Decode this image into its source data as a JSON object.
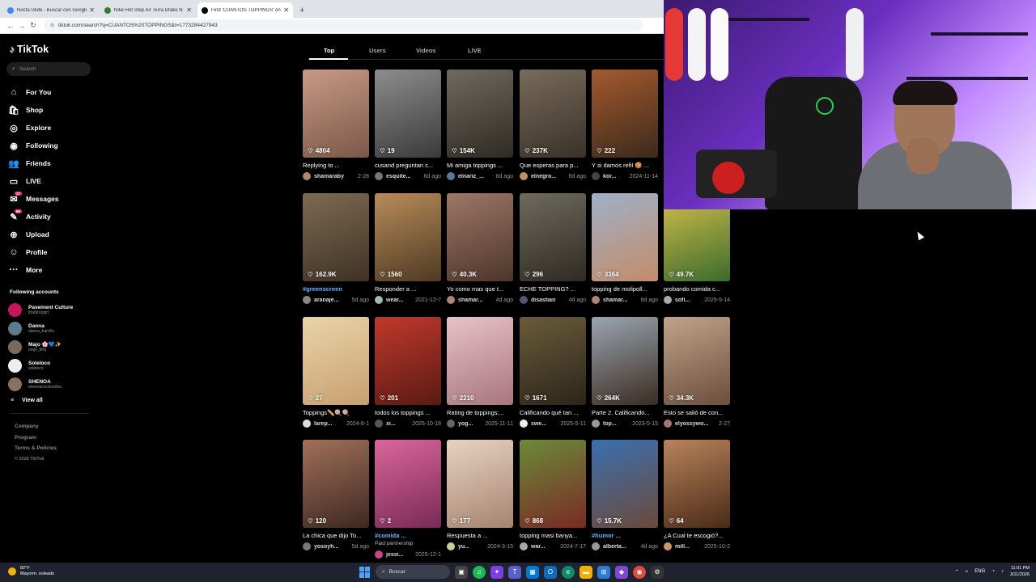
{
  "browser": {
    "tabs": [
      {
        "title": "Nocta Glide - Buscar con Google",
        "color": "#4285f4",
        "active": false
      },
      {
        "title": "Nike Hot Step Air Terra Drake N",
        "color": "#2e7d32",
        "active": false
      },
      {
        "title": "Find 'CUANTOS TOPPINGS' on T",
        "color": "#000000",
        "active": true
      }
    ],
    "new_tab": "+",
    "url": "tiktok.com/search?q=CUANTOS%20TOPPINGS&t=1773284427943"
  },
  "sidebar": {
    "logo": "TikTok",
    "search_placeholder": "Search",
    "nav": [
      {
        "label": "For You",
        "icon": "home-icon"
      },
      {
        "label": "Shop",
        "icon": "shop-icon"
      },
      {
        "label": "Explore",
        "icon": "compass-icon"
      },
      {
        "label": "Following",
        "icon": "following-icon"
      },
      {
        "label": "Friends",
        "icon": "friends-icon"
      },
      {
        "label": "LIVE",
        "icon": "live-icon"
      },
      {
        "label": "Messages",
        "icon": "messages-icon",
        "badge": "17"
      },
      {
        "label": "Activity",
        "icon": "activity-icon",
        "badge": "66"
      },
      {
        "label": "Upload",
        "icon": "upload-icon"
      },
      {
        "label": "Profile",
        "icon": "profile-icon"
      },
      {
        "label": "More",
        "icon": "more-icon"
      }
    ],
    "following_title": "Following accounts",
    "following": [
      {
        "name": "Pavement Culture",
        "handle": "thatdropgirl",
        "color": "#c2185b"
      },
      {
        "name": "Danna",
        "handle": "danna_barri0s",
        "color": "#5d7b8a"
      },
      {
        "name": "Majo 🌸💙✨",
        "handle": "majo_bhq",
        "color": "#7a6a5d"
      },
      {
        "name": "Soleloco",
        "handle": "soleloco",
        "color": "#eeeeee"
      },
      {
        "name": "SHENOA",
        "handle": "shenoarocolombia",
        "color": "#8d6e63"
      }
    ],
    "view_all": "View all",
    "footer": [
      "Company",
      "Program",
      "Terms & Policies"
    ],
    "copyright": "© 2026 TikTok"
  },
  "content_tabs": [
    "Top",
    "Users",
    "Videos",
    "LIVE"
  ],
  "cards": [
    {
      "views": "4804",
      "title": "Replying to ...",
      "user": "shamaraby",
      "date": "2-28",
      "c1": "#c79a86",
      "c2": "#7a5848",
      "av": "#b0866f"
    },
    {
      "views": "19",
      "title": "cusand preguntan c...",
      "user": "esquite...",
      "date": "6d ago",
      "c1": "#8d8d8d",
      "c2": "#3a3a3a",
      "av": "#777"
    },
    {
      "views": "154K",
      "title": "Mi amiga toppings ...",
      "user": "elnariz_...",
      "date": "6d ago",
      "c1": "#6e6a5e",
      "c2": "#2f2b24",
      "av": "#5b7b9c"
    },
    {
      "views": "237K",
      "title": "Que esperas para p...",
      "user": "elnegro...",
      "date": "6d ago",
      "c1": "#776b5a",
      "c2": "#3a3128",
      "av": "#c09060"
    },
    {
      "views": "222",
      "title": "Y si damos refil 🍪 ...",
      "user": "kor...",
      "date": "2024-11-14",
      "c1": "#a45a2e",
      "c2": "#3b2a1b",
      "av": "#444"
    },
    {
      "views": "162.9K",
      "title": "#greenscreen",
      "tag": true,
      "user": "aranaje...",
      "date": "5d ago",
      "c1": "#7d6a52",
      "c2": "#3f3224",
      "av": "#888"
    },
    {
      "views": "1560",
      "title": "Responder a ...",
      "user": "wear...",
      "date": "2021-12-7",
      "c1": "#b88c5a",
      "c2": "#4e3a22",
      "av": "#9bb"
    },
    {
      "views": "40.3K",
      "title": "Yo como mas que t...",
      "user": "shamar...",
      "date": "4d ago",
      "c1": "#9d7767",
      "c2": "#4d352a",
      "av": "#b0866f"
    },
    {
      "views": "296",
      "title": "ECHE TOPPING? ...",
      "user": "disastian",
      "date": "4d ago",
      "c1": "#6e6a5e",
      "c2": "#2f2b24",
      "av": "#557"
    },
    {
      "views": "3364",
      "title": "topping de molipoll...",
      "user": "shamar...",
      "date": "6d ago",
      "c1": "#9fb0c7",
      "c2": "#c38c6a",
      "av": "#b0866f"
    },
    {
      "views": "49.7K",
      "title": "probando comida c...",
      "user": "sofi...",
      "date": "2025-5-14",
      "c1": "#d5c04c",
      "c2": "#3b6b2c",
      "av": "#aaa"
    },
    {
      "views": "27",
      "title": "Toppings✏️🍭🍭",
      "user": "larep...",
      "date": "2024-8-1",
      "c1": "#e8d4a8",
      "c2": "#c8a070",
      "av": "#ddd"
    },
    {
      "views": "201",
      "title": "todos los toppings ...",
      "user": "xi...",
      "date": "2025-10-18",
      "c1": "#c0392b",
      "c2": "#5a1a14",
      "av": "#555"
    },
    {
      "views": "2210",
      "title": "Rating de toppings:...",
      "user": "yog...",
      "date": "2025-11-11",
      "c1": "#e6c3c8",
      "c2": "#a8757d",
      "av": "#666"
    },
    {
      "views": "1671",
      "title": "Calificando qué tan ...",
      "user": "swe...",
      "date": "2025-5-11",
      "c1": "#6a5c3a",
      "c2": "#2b241a",
      "av": "#eee"
    },
    {
      "views": "264K",
      "title": "Parte 2. Calificando...",
      "user": "top...",
      "date": "2023-5-15",
      "c1": "#9aa6b0",
      "c2": "#3a2b22",
      "av": "#999"
    },
    {
      "views": "34.3K",
      "title": "Esto se salió de con...",
      "user": "elyossywo...",
      "date": "2-27",
      "c1": "#bfa48a",
      "c2": "#6b4e3c",
      "av": "#a77"
    },
    {
      "views": "120",
      "title": "La chica que dijo To...",
      "user": "yosoyh...",
      "date": "5d ago",
      "c1": "#a0705a",
      "c2": "#3e2820",
      "av": "#777"
    },
    {
      "views": "2",
      "title": "#comida ...",
      "tag": true,
      "paid": "Paid partnership",
      "user": "jessi...",
      "date": "2025-12-1",
      "c1": "#d9669a",
      "c2": "#7a2a56",
      "av": "#c48"
    },
    {
      "views": "177",
      "title": "Respuesta a ...",
      "user": "yu...",
      "date": "2024-3-15",
      "c1": "#e8d2c2",
      "c2": "#a68470",
      "av": "#cc9"
    },
    {
      "views": "868",
      "title": "topping masi banya...",
      "user": "war...",
      "date": "2024-7-17",
      "c1": "#6b8a3a",
      "c2": "#7a2a24",
      "av": "#aaa"
    },
    {
      "views": "15.7K",
      "title": "#humor ...",
      "tag": true,
      "user": "alberta...",
      "date": "4d ago",
      "c1": "#3b6fb0",
      "c2": "#6b4a3a",
      "av": "#999"
    },
    {
      "views": "64",
      "title": "¿A Cual te escogió?...",
      "user": "mill...",
      "date": "2025-10-2",
      "c1": "#b8845a",
      "c2": "#4a2a18",
      "av": "#c96"
    }
  ],
  "taskbar": {
    "temp": "82°F",
    "weather": "Mayorm. soleado",
    "search": "Buscar",
    "lang": "ENG",
    "time": "11:01 PM",
    "date": "3/11/2026"
  }
}
